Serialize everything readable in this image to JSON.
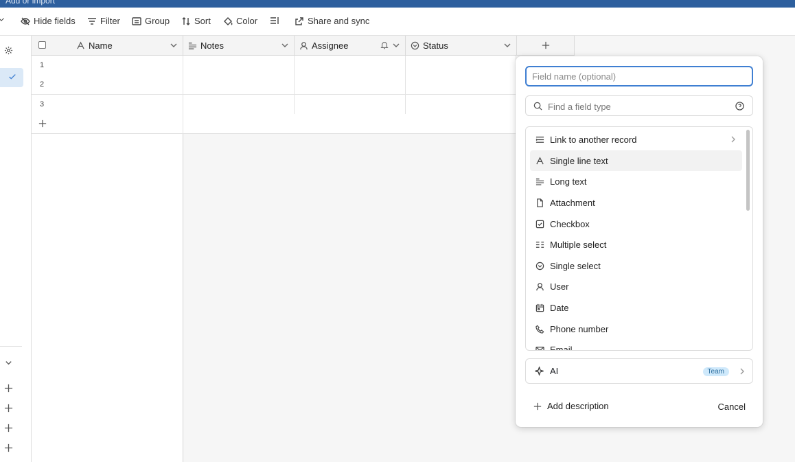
{
  "window": {
    "title": "Add or import"
  },
  "toolbar": {
    "hide_fields": "Hide fields",
    "filter": "Filter",
    "group": "Group",
    "sort": "Sort",
    "color": "Color",
    "share_sync": "Share and sync"
  },
  "grid": {
    "columns": [
      {
        "label": "Name",
        "icon": "text-a-icon"
      },
      {
        "label": "Notes",
        "icon": "long-text-icon"
      },
      {
        "label": "Assignee",
        "icon": "user-icon"
      },
      {
        "label": "Status",
        "icon": "single-select-icon"
      }
    ],
    "rows": [
      {
        "number": "1"
      },
      {
        "number": "2"
      },
      {
        "number": "3"
      }
    ]
  },
  "field_panel": {
    "name_placeholder": "Field name (optional)",
    "search_placeholder": "Find a field type",
    "types": [
      {
        "label": "Link to another record",
        "icon": "link-record-icon",
        "has_submenu": true
      },
      {
        "label": "Single line text",
        "icon": "text-a-icon",
        "selected": true
      },
      {
        "label": "Long text",
        "icon": "long-text-icon"
      },
      {
        "label": "Attachment",
        "icon": "file-icon"
      },
      {
        "label": "Checkbox",
        "icon": "checkbox-icon"
      },
      {
        "label": "Multiple select",
        "icon": "multi-select-icon"
      },
      {
        "label": "Single select",
        "icon": "single-select-icon"
      },
      {
        "label": "User",
        "icon": "user-icon"
      },
      {
        "label": "Date",
        "icon": "calendar-icon"
      },
      {
        "label": "Phone number",
        "icon": "phone-icon"
      },
      {
        "label": "Email",
        "icon": "mail-icon"
      }
    ],
    "ai": {
      "label": "AI",
      "badge": "Team"
    },
    "add_description": "Add description",
    "cancel": "Cancel"
  },
  "colors": {
    "accent": "#3f7fd2",
    "topbar": "#2d5f9e",
    "badge_bg": "#cfe9fb"
  }
}
